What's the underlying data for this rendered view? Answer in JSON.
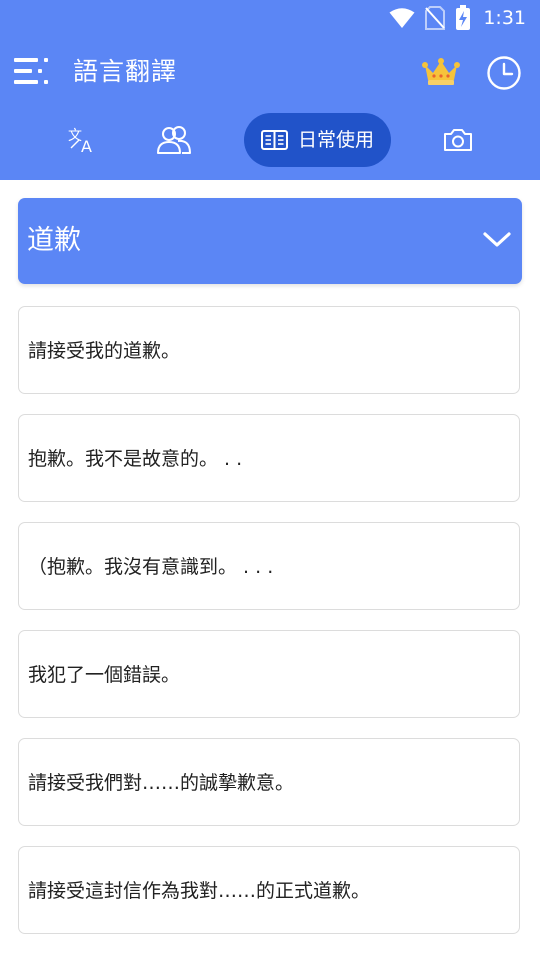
{
  "status_bar": {
    "time": "1:31",
    "icons": [
      "wifi-icon",
      "no-sim-icon",
      "battery-charging-icon"
    ]
  },
  "app_bar": {
    "title": "語言翻譯",
    "icons": [
      "menu-icon",
      "crown-icon",
      "history-icon"
    ]
  },
  "tabs": [
    {
      "icon": "translate-icon",
      "label": ""
    },
    {
      "icon": "people-icon",
      "label": ""
    },
    {
      "icon": "book-icon",
      "label": "日常使用",
      "selected": true
    },
    {
      "icon": "camera-icon",
      "label": ""
    }
  ],
  "category": {
    "label": "道歉",
    "icon": "chevron-down-icon"
  },
  "phrases": [
    "請接受我的道歉。",
    "抱歉。我不是故意的。 . .",
    "（抱歉。我沒有意識到。 . . .",
    "我犯了一個錯誤。",
    "請接受我們對……的誠摯歉意。",
    "請接受這封信作為我對……的正式道歉。"
  ],
  "colors": {
    "primary": "#5B86F5",
    "tab_selected": "#2153C9",
    "crown": "#F6C33B",
    "text": "#222222",
    "card_border": "#dcdcdc"
  }
}
